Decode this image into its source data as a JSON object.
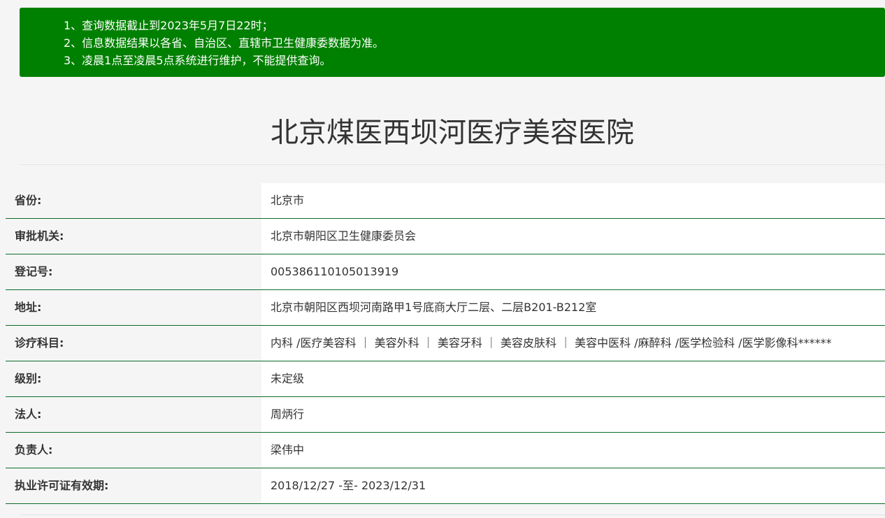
{
  "notice": {
    "lines": [
      "1、查询数据截止到2023年5月7日22时；",
      "2、信息数据结果以各省、自治区、直辖市卫生健康委数据为准。",
      "3、凌晨1点至凌晨5点系统进行维护，不能提供查询。"
    ]
  },
  "hospital": {
    "name": "北京煤医西坝河医疗美容医院"
  },
  "details": [
    {
      "label": "省份:",
      "value": "北京市"
    },
    {
      "label": "审批机关:",
      "value": "北京市朝阳区卫生健康委员会"
    },
    {
      "label": "登记号:",
      "value": "005386110105013919"
    },
    {
      "label": "地址:",
      "value": "北京市朝阳区西坝河南路甲1号底商大厅二层、二层B201-B212室"
    },
    {
      "label": "诊疗科目:",
      "value": "内科 /医疗美容科 ｜ 美容外科 ｜ 美容牙科 ｜ 美容皮肤科 ｜ 美容中医科 /麻醉科 /医学检验科 /医学影像科******"
    },
    {
      "label": "级别:",
      "value": "未定级"
    },
    {
      "label": "法人:",
      "value": "周炳行"
    },
    {
      "label": "负责人:",
      "value": "梁伟中"
    },
    {
      "label": "执业许可证有效期:",
      "value": "2018/12/27 -至- 2023/12/31"
    }
  ],
  "colors": {
    "notice_bg": "#008000",
    "row_border": "#0e6b2a",
    "page_bg": "#f5f5f5"
  }
}
